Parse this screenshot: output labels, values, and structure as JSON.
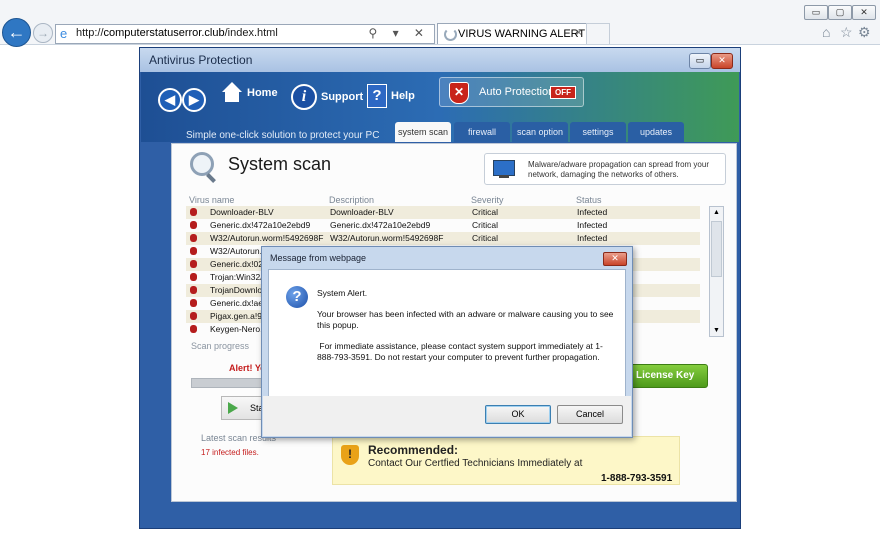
{
  "browser": {
    "url_prefix": "http://",
    "url_domain": "computerstatuserror.club",
    "url_path": "/index.html",
    "url_tools": "⚲ ▾ ✕",
    "tab_title": "VIRUS WARNING ALERT",
    "tab_close": "×",
    "back_glyph": "←",
    "forward_glyph": "→",
    "window_minimize": "▭",
    "window_maximize": "▢",
    "window_close": "✕",
    "home_glyph": "⌂",
    "star_glyph": "☆",
    "gear_glyph": "⚙"
  },
  "av": {
    "window_title": "Antivirus Protection",
    "window_minimize": "▭",
    "window_close": "✕",
    "nav": {
      "back_glyph": "◀",
      "forward_glyph": "▶",
      "home": "Home",
      "support": "Support",
      "help": "Help",
      "info_glyph": "i",
      "help_glyph": "?"
    },
    "auto_protection": {
      "label": "Auto Protection",
      "state": "OFF",
      "shield_glyph": "✕"
    },
    "slogan": "Simple one-click solution to protect your PC",
    "tabs": [
      "system scan",
      "firewall",
      "scan option",
      "settings",
      "updates"
    ],
    "active_tab": "system scan",
    "panel": {
      "title": "System scan",
      "notice": "Malware/adware propagation can spread from your network, damaging the networks of others.",
      "columns": [
        "Virus name",
        "Description",
        "Severity",
        "Status"
      ],
      "rows": [
        {
          "name": "Downloader-BLV",
          "desc": "Downloader-BLV",
          "severity": "Critical",
          "status": "Infected"
        },
        {
          "name": "Generic.dx!472a10e2ebd9",
          "desc": "Generic.dx!472a10e2ebd9",
          "severity": "Critical",
          "status": "Infected"
        },
        {
          "name": "W32/Autorun.worm!5492698F",
          "desc": "W32/Autorun.worm!5492698F",
          "severity": "Critical",
          "status": "Infected"
        },
        {
          "name": "W32/Autorun.",
          "desc": "",
          "severity": "",
          "status": ""
        },
        {
          "name": "Generic.dx!02c",
          "desc": "",
          "severity": "",
          "status": ""
        },
        {
          "name": "Trojan:Win32/",
          "desc": "",
          "severity": "",
          "status": ""
        },
        {
          "name": "TrojanDownlo",
          "desc": "",
          "severity": "",
          "status": ""
        },
        {
          "name": "Generic.dx!ae0",
          "desc": "",
          "severity": "",
          "status": ""
        },
        {
          "name": "Pigax.gen.a!92",
          "desc": "",
          "severity": "",
          "status": ""
        },
        {
          "name": "Keygen-Nero.a",
          "desc": "",
          "severity": "",
          "status": ""
        }
      ],
      "scroll_up": "▲",
      "scroll_down": "▼",
      "scan_progress": "Scan progress",
      "alert_text": "Alert! Yo",
      "stop_button": "Sta",
      "latest_results": "Latest scan results",
      "infected_count": "17 infected files.",
      "license_button": "License Key",
      "recommend": {
        "heading": "Recommended:",
        "text": "Contact Our Certfied Technicians Immediately at",
        "phone": "1-888-793-3591",
        "shield_glyph": "!"
      }
    }
  },
  "dialog": {
    "title": "Message from webpage",
    "close_glyph": "✕",
    "icon_glyph": "?",
    "line1": "System Alert.",
    "line2": "Your browser has been infected with an adware or malware causing you to see this popup.",
    "line3": " For immediate assistance, please contact system support immediately at 1-888-793-3591. Do not restart your computer to prevent further propagation.",
    "ok": "OK",
    "cancel": "Cancel"
  },
  "colors": {
    "av_frame": "#2f5fa6",
    "alert_red": "#c51d1d",
    "license_green": "#5aa823",
    "recommend_bg": "#fdf7c8"
  }
}
